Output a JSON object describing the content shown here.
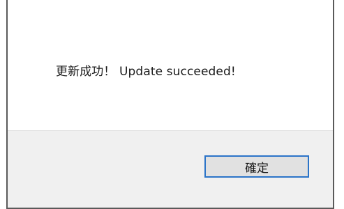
{
  "dialog": {
    "message": "更新成功！ Update succeeded!",
    "ok_label": "確定"
  },
  "colors": {
    "footer_background": "#f0f0f0",
    "button_border": "#2b74c8",
    "button_background": "#e1e1e1"
  }
}
